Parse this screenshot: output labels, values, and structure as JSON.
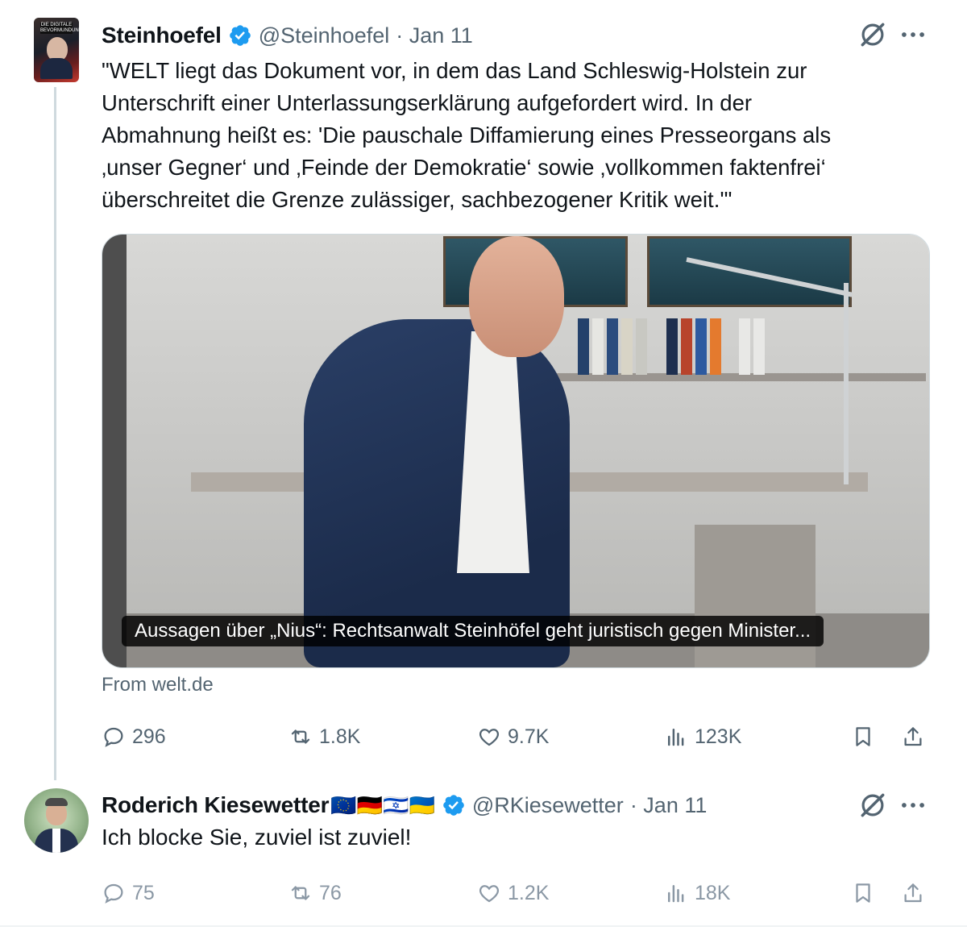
{
  "tweet1": {
    "author_name": "Steinhoefel",
    "author_handle": "@Steinhoefel",
    "date": "· Jan 11",
    "avatar_text": "DIE DIGITALE BEVORMUNDUNG",
    "text": "\"WELT liegt das Dokument vor, in dem das Land Schleswig-Holstein zur\nUnterschrift einer Unterlassungserklärung aufgefordert wird. In der\nAbmahnung heißt es: 'Die pauschale Diffamierung eines  Presseorgans als\n‚unser Gegner‘ und ‚Feinde der Demokratie‘ sowie  ‚vollkommen faktenfrei‘\nüberschreitet die Grenze zulässiger,  sachbezogener Kritik weit.'\"",
    "link_card": {
      "caption": "Aussagen über „Nius“: Rechtsanwalt Steinhöfel geht juristisch gegen Minister...",
      "source": "From welt.de"
    },
    "metrics": {
      "replies": "296",
      "reposts": "1.8K",
      "likes": "9.7K",
      "views": "123K"
    }
  },
  "tweet2": {
    "author_name": "Roderich Kiesewetter",
    "author_flags": "🇪🇺🇩🇪🇮🇱🇺🇦",
    "author_handle": "@RKiesewetter",
    "date": "· Jan 11",
    "text": "Ich blocke Sie, zuviel ist zuviel!",
    "metrics": {
      "replies": "75",
      "reposts": "76",
      "likes": "1.2K",
      "views": "18K"
    }
  },
  "icons": {
    "verified": "verified-badge-icon",
    "grok": "grok-icon",
    "more": "more-icon",
    "reply": "reply-icon",
    "repost": "repost-icon",
    "like": "like-icon",
    "views": "views-icon",
    "bookmark": "bookmark-icon",
    "share": "share-icon"
  },
  "colors": {
    "verified_blue": "#1d9bf0",
    "text": "#0f1419",
    "secondary": "#536471",
    "thread_line": "#cfd9de"
  }
}
